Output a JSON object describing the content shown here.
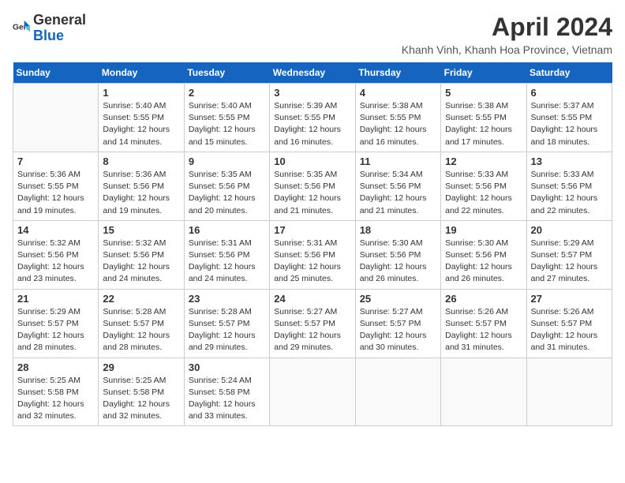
{
  "logo": {
    "general": "General",
    "blue": "Blue"
  },
  "title": "April 2024",
  "subtitle": "Khanh Vinh, Khanh Hoa Province, Vietnam",
  "days": [
    "Sunday",
    "Monday",
    "Tuesday",
    "Wednesday",
    "Thursday",
    "Friday",
    "Saturday"
  ],
  "weeks": [
    [
      {
        "day": "",
        "info": ""
      },
      {
        "day": "1",
        "info": "Sunrise: 5:40 AM\nSunset: 5:55 PM\nDaylight: 12 hours\nand 14 minutes."
      },
      {
        "day": "2",
        "info": "Sunrise: 5:40 AM\nSunset: 5:55 PM\nDaylight: 12 hours\nand 15 minutes."
      },
      {
        "day": "3",
        "info": "Sunrise: 5:39 AM\nSunset: 5:55 PM\nDaylight: 12 hours\nand 16 minutes."
      },
      {
        "day": "4",
        "info": "Sunrise: 5:38 AM\nSunset: 5:55 PM\nDaylight: 12 hours\nand 16 minutes."
      },
      {
        "day": "5",
        "info": "Sunrise: 5:38 AM\nSunset: 5:55 PM\nDaylight: 12 hours\nand 17 minutes."
      },
      {
        "day": "6",
        "info": "Sunrise: 5:37 AM\nSunset: 5:55 PM\nDaylight: 12 hours\nand 18 minutes."
      }
    ],
    [
      {
        "day": "7",
        "info": "Sunrise: 5:36 AM\nSunset: 5:55 PM\nDaylight: 12 hours\nand 19 minutes."
      },
      {
        "day": "8",
        "info": "Sunrise: 5:36 AM\nSunset: 5:56 PM\nDaylight: 12 hours\nand 19 minutes."
      },
      {
        "day": "9",
        "info": "Sunrise: 5:35 AM\nSunset: 5:56 PM\nDaylight: 12 hours\nand 20 minutes."
      },
      {
        "day": "10",
        "info": "Sunrise: 5:35 AM\nSunset: 5:56 PM\nDaylight: 12 hours\nand 21 minutes."
      },
      {
        "day": "11",
        "info": "Sunrise: 5:34 AM\nSunset: 5:56 PM\nDaylight: 12 hours\nand 21 minutes."
      },
      {
        "day": "12",
        "info": "Sunrise: 5:33 AM\nSunset: 5:56 PM\nDaylight: 12 hours\nand 22 minutes."
      },
      {
        "day": "13",
        "info": "Sunrise: 5:33 AM\nSunset: 5:56 PM\nDaylight: 12 hours\nand 22 minutes."
      }
    ],
    [
      {
        "day": "14",
        "info": "Sunrise: 5:32 AM\nSunset: 5:56 PM\nDaylight: 12 hours\nand 23 minutes."
      },
      {
        "day": "15",
        "info": "Sunrise: 5:32 AM\nSunset: 5:56 PM\nDaylight: 12 hours\nand 24 minutes."
      },
      {
        "day": "16",
        "info": "Sunrise: 5:31 AM\nSunset: 5:56 PM\nDaylight: 12 hours\nand 24 minutes."
      },
      {
        "day": "17",
        "info": "Sunrise: 5:31 AM\nSunset: 5:56 PM\nDaylight: 12 hours\nand 25 minutes."
      },
      {
        "day": "18",
        "info": "Sunrise: 5:30 AM\nSunset: 5:56 PM\nDaylight: 12 hours\nand 26 minutes."
      },
      {
        "day": "19",
        "info": "Sunrise: 5:30 AM\nSunset: 5:56 PM\nDaylight: 12 hours\nand 26 minutes."
      },
      {
        "day": "20",
        "info": "Sunrise: 5:29 AM\nSunset: 5:57 PM\nDaylight: 12 hours\nand 27 minutes."
      }
    ],
    [
      {
        "day": "21",
        "info": "Sunrise: 5:29 AM\nSunset: 5:57 PM\nDaylight: 12 hours\nand 28 minutes."
      },
      {
        "day": "22",
        "info": "Sunrise: 5:28 AM\nSunset: 5:57 PM\nDaylight: 12 hours\nand 28 minutes."
      },
      {
        "day": "23",
        "info": "Sunrise: 5:28 AM\nSunset: 5:57 PM\nDaylight: 12 hours\nand 29 minutes."
      },
      {
        "day": "24",
        "info": "Sunrise: 5:27 AM\nSunset: 5:57 PM\nDaylight: 12 hours\nand 29 minutes."
      },
      {
        "day": "25",
        "info": "Sunrise: 5:27 AM\nSunset: 5:57 PM\nDaylight: 12 hours\nand 30 minutes."
      },
      {
        "day": "26",
        "info": "Sunrise: 5:26 AM\nSunset: 5:57 PM\nDaylight: 12 hours\nand 31 minutes."
      },
      {
        "day": "27",
        "info": "Sunrise: 5:26 AM\nSunset: 5:57 PM\nDaylight: 12 hours\nand 31 minutes."
      }
    ],
    [
      {
        "day": "28",
        "info": "Sunrise: 5:25 AM\nSunset: 5:58 PM\nDaylight: 12 hours\nand 32 minutes."
      },
      {
        "day": "29",
        "info": "Sunrise: 5:25 AM\nSunset: 5:58 PM\nDaylight: 12 hours\nand 32 minutes."
      },
      {
        "day": "30",
        "info": "Sunrise: 5:24 AM\nSunset: 5:58 PM\nDaylight: 12 hours\nand 33 minutes."
      },
      {
        "day": "",
        "info": ""
      },
      {
        "day": "",
        "info": ""
      },
      {
        "day": "",
        "info": ""
      },
      {
        "day": "",
        "info": ""
      }
    ]
  ]
}
